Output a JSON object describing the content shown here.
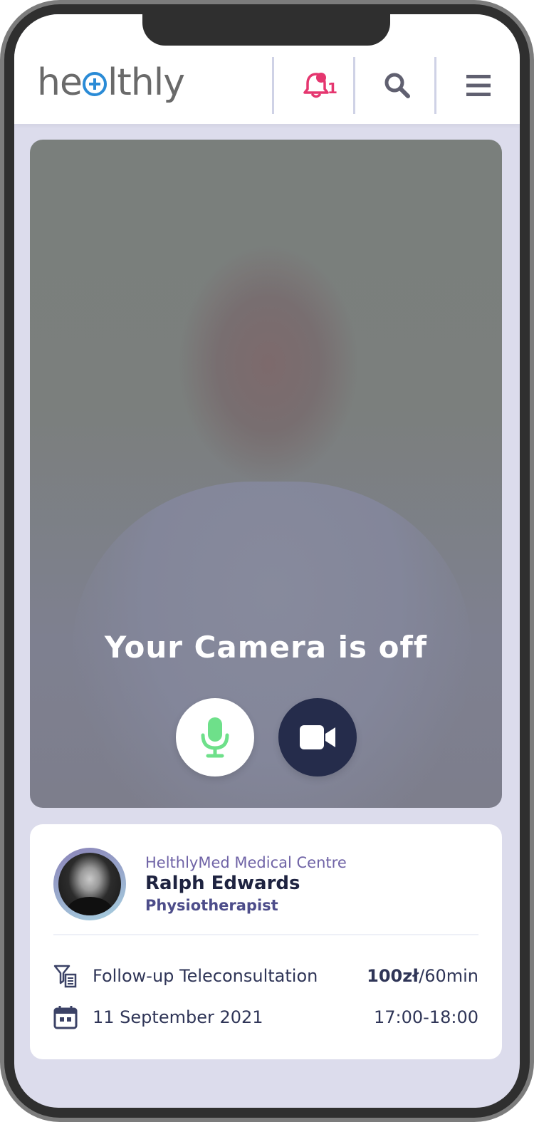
{
  "header": {
    "logo_prefix": "he",
    "logo_suffix": "lthly",
    "notification_count": "1",
    "icons": [
      "bell-icon",
      "search-icon",
      "hamburger-menu-icon"
    ]
  },
  "video": {
    "camera_status": "Your Camera is off",
    "mic_icon": "microphone-icon",
    "camera_icon": "video-camera-icon"
  },
  "appointment": {
    "centre": "HelthlyMed Medical Centre",
    "doctor_name": "Ralph Edwards",
    "specialty": "Physiotherapist",
    "service": "Follow-up Teleconsultation",
    "price": "100zł",
    "duration": "/60min",
    "date": "11 September 2021",
    "time": "17:00-18:00"
  },
  "colors": {
    "brand_blue": "#2a8bd6",
    "notification_pink": "#e5366f",
    "mic_green": "#6ee08a",
    "navy": "#252c4b",
    "accent_purple": "#6f63a6"
  }
}
